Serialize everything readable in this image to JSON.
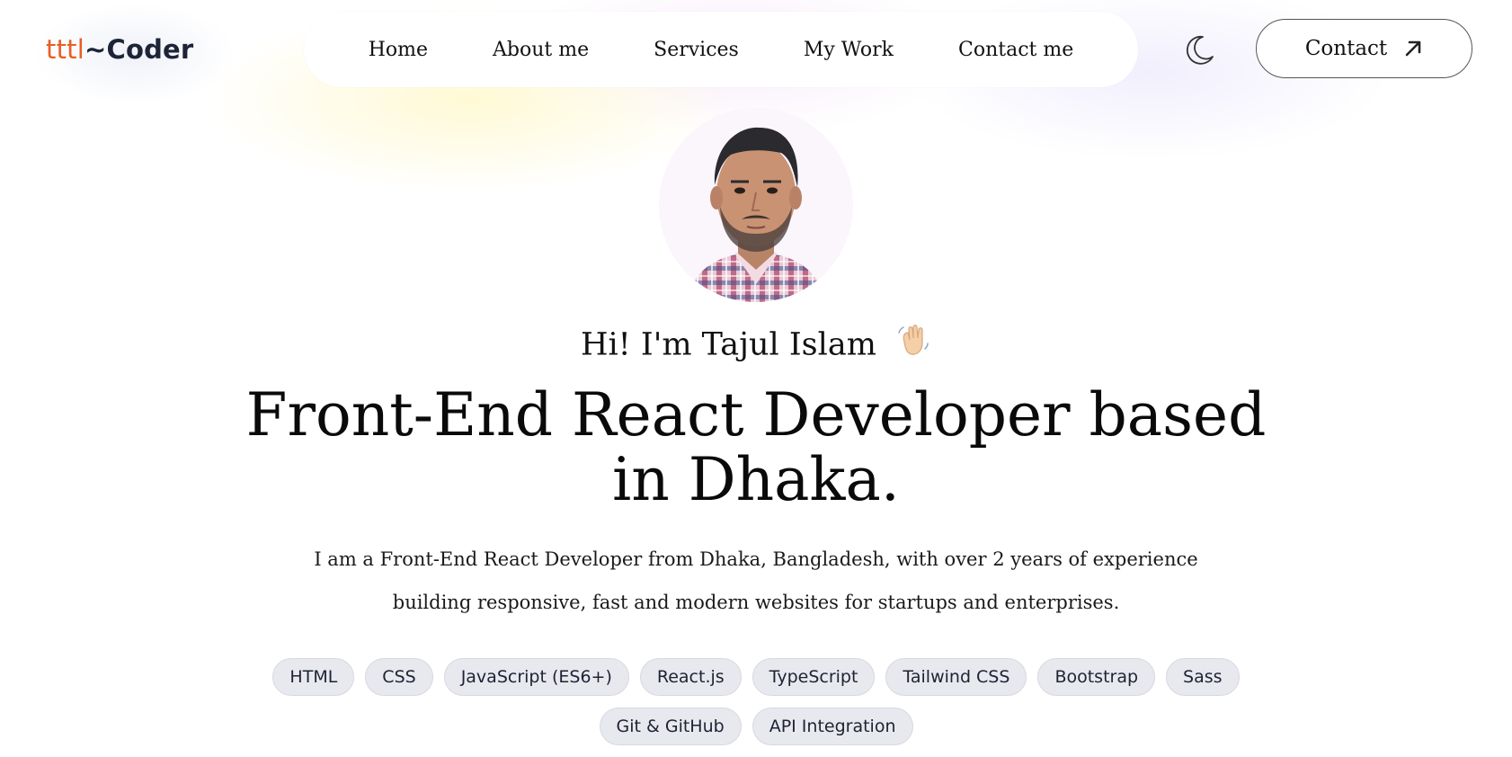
{
  "logo": {
    "accent": "tttl",
    "main": "~Coder"
  },
  "nav": {
    "items": [
      "Home",
      "About me",
      "Services",
      "My Work",
      "Contact me"
    ]
  },
  "header": {
    "theme_icon": "moon-icon",
    "contact_label": "Contact",
    "contact_icon": "arrow-up-right-icon"
  },
  "hero": {
    "avatar_icon": "profile-photo",
    "greeting": "Hi! I'm Tajul Islam",
    "greeting_emoji": "waving-hand-icon",
    "headline": "Front-End React Developer based in Dhaka.",
    "intro": "I am a Front-End React Developer from Dhaka, Bangladesh, with over 2 years of experience building responsive, fast and modern websites for startups and enterprises."
  },
  "skills": [
    "HTML",
    "CSS",
    "JavaScript (ES6+)",
    "React.js",
    "TypeScript",
    "Tailwind CSS",
    "Bootstrap",
    "Sass",
    "Git & GitHub",
    "API Integration"
  ],
  "colors": {
    "logo_accent": "#e85d24",
    "logo_main": "#1d2438",
    "chip_bg": "#e8e9ee",
    "text": "#111111"
  }
}
